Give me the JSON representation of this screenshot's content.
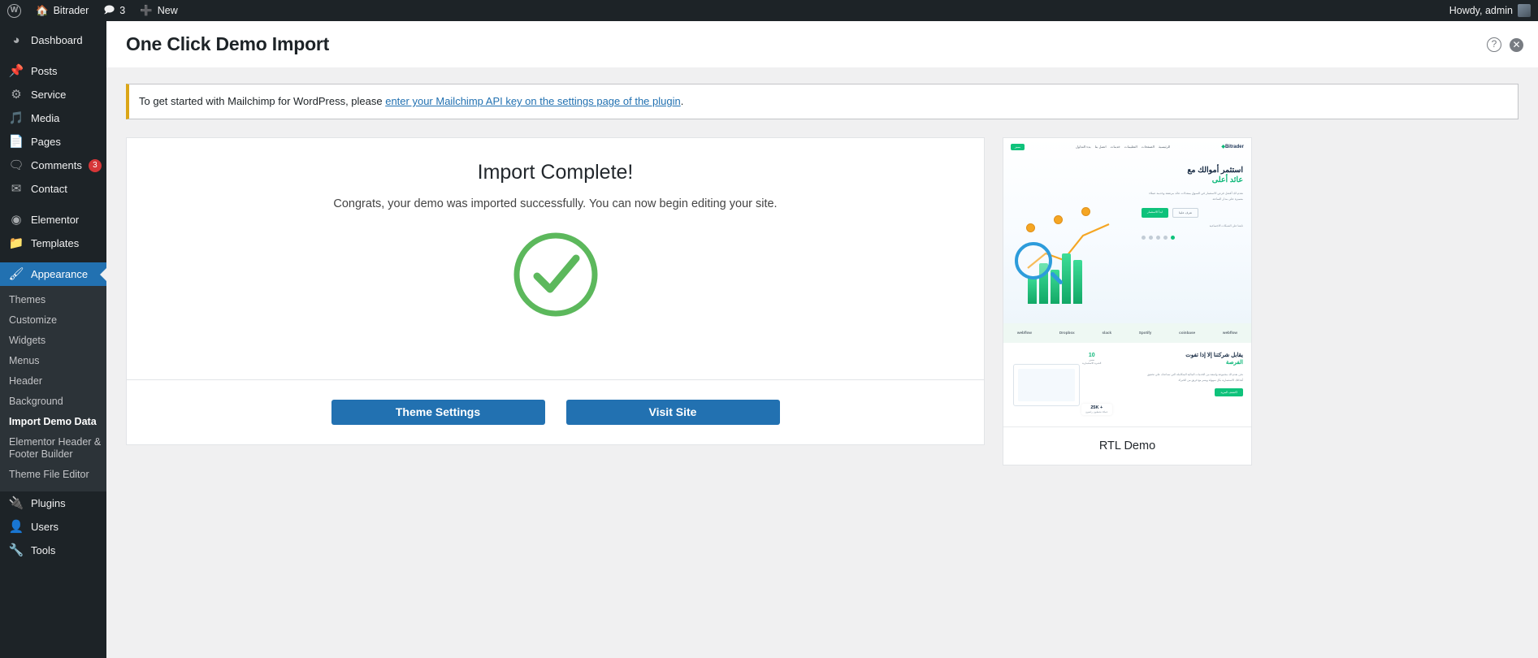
{
  "adminbar": {
    "wp_logo": "wordpress-logo",
    "site_name": "Bitrader",
    "comment_count": "3",
    "new_label": "New",
    "howdy": "Howdy, admin"
  },
  "sidebar": {
    "items": [
      {
        "label": "Dashboard",
        "icon": "dashboard-icon",
        "badge": ""
      },
      {
        "label": "Posts",
        "icon": "pin-icon",
        "badge": ""
      },
      {
        "label": "Service",
        "icon": "gear-icon",
        "badge": ""
      },
      {
        "label": "Media",
        "icon": "media-icon",
        "badge": ""
      },
      {
        "label": "Pages",
        "icon": "pages-icon",
        "badge": ""
      },
      {
        "label": "Comments",
        "icon": "comment-icon",
        "badge": "3"
      },
      {
        "label": "Contact",
        "icon": "envelope-icon",
        "badge": ""
      },
      {
        "label": "Elementor",
        "icon": "elementor-icon",
        "badge": ""
      },
      {
        "label": "Templates",
        "icon": "folder-icon",
        "badge": ""
      },
      {
        "label": "Appearance",
        "icon": "brush-icon",
        "badge": ""
      },
      {
        "label": "Plugins",
        "icon": "plug-icon",
        "badge": ""
      },
      {
        "label": "Users",
        "icon": "user-icon",
        "badge": ""
      },
      {
        "label": "Tools",
        "icon": "wrench-icon",
        "badge": ""
      }
    ],
    "appearance_submenu": [
      "Themes",
      "Customize",
      "Widgets",
      "Menus",
      "Header",
      "Background",
      "Import Demo Data",
      "Elementor Header & Footer Builder",
      "Theme File Editor"
    ],
    "active_submenu": "Import Demo Data"
  },
  "header": {
    "title": "One Click Demo Import",
    "help_icon": "help-icon",
    "close_icon": "close-icon"
  },
  "notice": {
    "text_before": "To get started with Mailchimp for WordPress, please ",
    "link_text": "enter your Mailchimp API key on the settings page of the plugin",
    "text_after": "."
  },
  "import": {
    "heading": "Import Complete!",
    "subtitle": "Congrats, your demo was imported successfully. You can now begin editing your site.",
    "success_icon": "check-circle-icon",
    "theme_settings_button": "Theme Settings",
    "visit_site_button": "Visit Site"
  },
  "preview": {
    "caption": "RTL Demo",
    "mock": {
      "logo": "Bitrader",
      "badge": "مميز",
      "nav": [
        "بدء التداول",
        "اتصل بنا",
        "خدمات",
        "التعليمات",
        "الصفحات",
        "الرئيسية"
      ],
      "headline_1": "استثمر أموالك مع",
      "headline_2": "عائد أعلى",
      "paragraph": "نقدم لك أفضل فرص الاستثمار في السوق بمعدلات عائد مرتفعة وخدمة عملاء متميزة على مدار الساعة.",
      "btn_primary": "ابدأ الاستثمار",
      "btn_secondary": "تعرف علينا",
      "social_label": "تابعنا على الشبكات الاجتماعية",
      "brands": [
        "webflow",
        "Dropbox",
        "slack",
        "Spotify",
        "coinbase",
        "webflow"
      ],
      "bottom_title_1": "يقابل شركتنا إلا إذا تفوت",
      "bottom_title_2": "الفرصة",
      "bottom_paragraph": "نحن نقدم لك مجموعة واسعة من الخدمات المالية المتكاملة التي تساعدك على تحقيق أهدافك الاستثمارية بكل سهولة ويسر مع فريق من الخبراء.",
      "bottom_btn": "اكتشف المزيد",
      "years_number": "10",
      "years_label": "سنين",
      "years_sub": "الخبرة الاستثمارية",
      "kpi_number": "+ 25K",
      "kpi_label": "عملاء نشطون راضون"
    }
  },
  "colors": {
    "accent_blue": "#2271b1",
    "sidebar_bg": "#1d2327",
    "notice_border": "#dba617",
    "success_green": "#5cb85c",
    "badge_red": "#d63638"
  }
}
